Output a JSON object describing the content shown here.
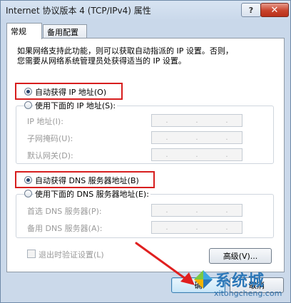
{
  "window": {
    "title": "Internet 协议版本 4 (TCP/IPv4) 属性",
    "help_label": "?",
    "close_label": "✕"
  },
  "tabs": [
    {
      "label": "常规"
    },
    {
      "label": "备用配置"
    }
  ],
  "description": {
    "line1": "如果网络支持此功能，则可以获取自动指派的 IP 设置。否则，",
    "line2": "您需要从网络系统管理员处获得适当的 IP 设置。"
  },
  "ip": {
    "auto_label": "自动获得 IP 地址(O)",
    "manual_label": "使用下面的 IP 地址(S):",
    "auto_selected": true,
    "fields": [
      {
        "label": "IP 地址(I):"
      },
      {
        "label": "子网掩码(U):"
      },
      {
        "label": "默认网关(D):"
      }
    ]
  },
  "dns": {
    "auto_label": "自动获得 DNS 服务器地址(B)",
    "manual_label": "使用下面的 DNS 服务器地址(E):",
    "auto_selected": true,
    "fields": [
      {
        "label": "首选 DNS 服务器(P):"
      },
      {
        "label": "备用 DNS 服务器(A):"
      }
    ]
  },
  "ip_dots": ".",
  "validate_label": "退出时验证设置(L)",
  "advanced_label": "高级(V)...",
  "ok_label": "确",
  "cancel_label": "取消",
  "watermark": {
    "text": "系统城",
    "domain": "xitongcheng.com"
  },
  "colors": {
    "highlight": "#d71e1e",
    "accent": "#2c77b8"
  }
}
